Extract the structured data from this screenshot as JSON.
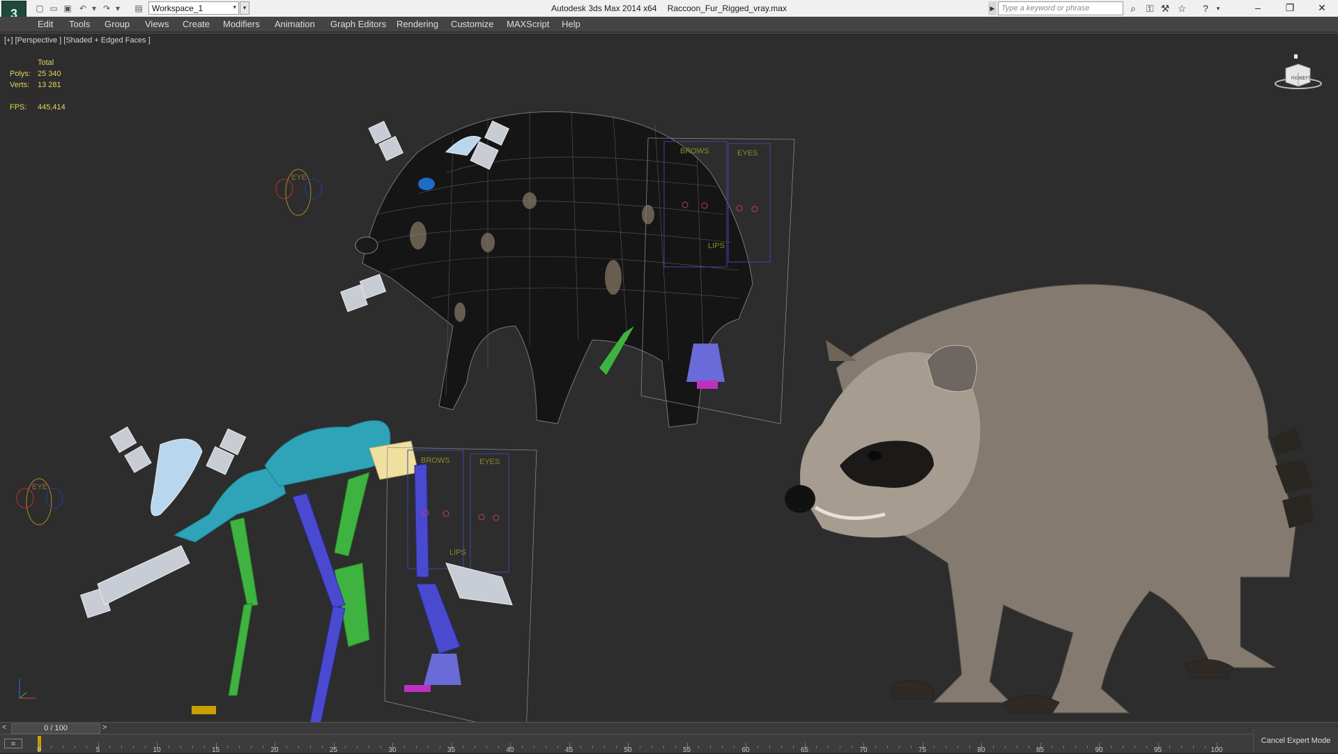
{
  "title_bar": {
    "app_name": "Autodesk 3ds Max  2014 x64",
    "file_name": "Raccoon_Fur_Rigged_vray.max",
    "workspace": "Workspace_1",
    "search_placeholder": "Type a keyword or phrase"
  },
  "menu": [
    "Edit",
    "Tools",
    "Group",
    "Views",
    "Create",
    "Modifiers",
    "Animation",
    "Graph Editors",
    "Rendering",
    "Customize",
    "MAXScript",
    "Help"
  ],
  "viewport": {
    "label": "[+] [Perspective ] [Shaded + Edged Faces ]",
    "stats": {
      "header": "Total",
      "polys_label": "Polys:",
      "polys": "25 340",
      "verts_label": "Verts:",
      "verts": "13 281",
      "fps_label": "FPS:",
      "fps": "445,414"
    },
    "viewcube_labels": {
      "left": "RIGHT",
      "right": "LEFT"
    },
    "rig_labels": {
      "brows": "BROWS",
      "eyes": "EYES",
      "lips": "LIPS",
      "eye": "EYE"
    }
  },
  "timeline": {
    "frame_display": "0 / 100",
    "prev": "<",
    "next": ">",
    "current_frame": 0,
    "ticks": [
      "0",
      "5",
      "10",
      "15",
      "20",
      "25",
      "30",
      "35",
      "40",
      "45",
      "50",
      "55",
      "60",
      "65",
      "70",
      "75",
      "80",
      "85",
      "90",
      "95",
      "100"
    ]
  },
  "status": {
    "expert_mode_button": "Cancel Expert Mode"
  },
  "colors": {
    "viewport_bg": "#2d2d2d",
    "stats_text": "#e6d25a",
    "menubar_bg": "#444444",
    "bone_cyan": "#2fa4b8",
    "bone_green": "#3fb33f",
    "bone_blue": "#4a4ad0"
  }
}
